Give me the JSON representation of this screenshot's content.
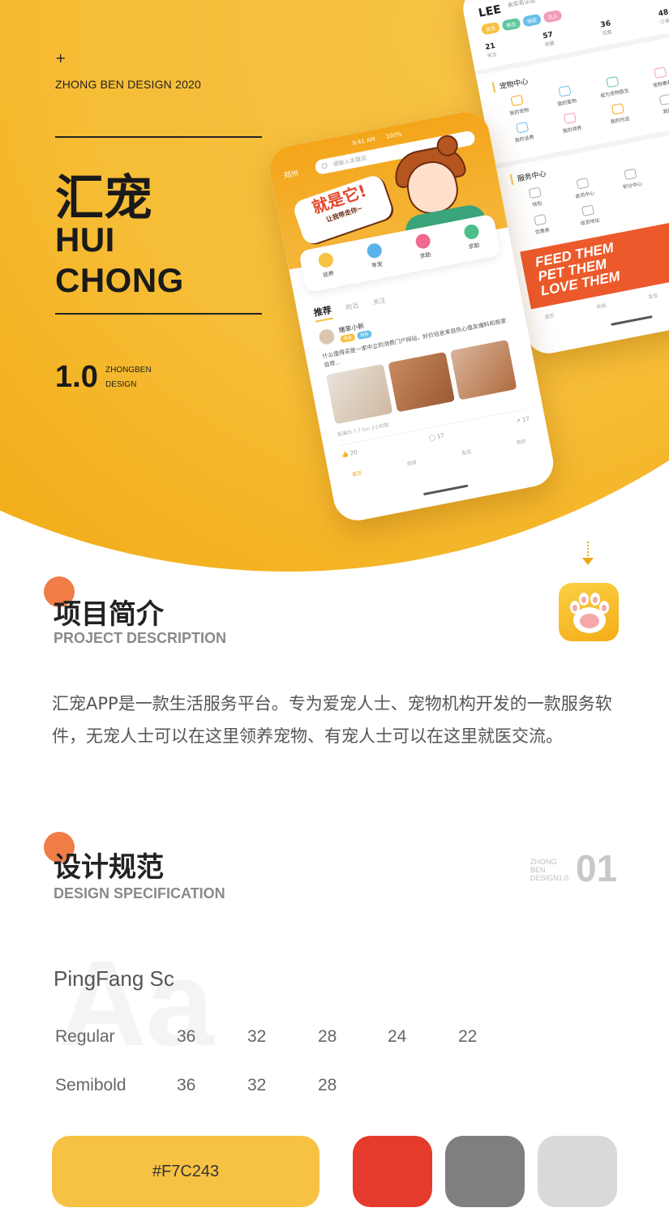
{
  "hero": {
    "plus": "+",
    "brand_line": "ZHONG BEN DESIGN 2020",
    "title_cn": "汇宠",
    "title_en_1": "HUI",
    "title_en_2": "CHONG",
    "version": "1.0",
    "version_sub_1": "ZHONGBEN",
    "version_sub_2": "DESIGN"
  },
  "back_phone": {
    "user": "LEE",
    "user_sub": "未实名认证",
    "tags": [
      "会员",
      "新生",
      "绑定",
      "达人"
    ],
    "stats": [
      {
        "value": "21",
        "label": "关注"
      },
      {
        "value": "57",
        "label": "收藏"
      },
      {
        "value": "36",
        "label": "回复"
      },
      {
        "value": "48",
        "label": "订单"
      }
    ],
    "pet_center": "宠物中心",
    "pet_items": [
      "我的宠物",
      "我的爱物",
      "成为宠物医生",
      "宠物寄养",
      "我的话费",
      "我的领养",
      "我的托运",
      "我的"
    ],
    "service_center": "服务中心",
    "service_items": [
      "钱包",
      "会员中心",
      "积分中心",
      "优惠券",
      "收货地址"
    ],
    "banner_1": "FEED THEM",
    "banner_2": "PET THEM",
    "banner_3": "LOVE THEM",
    "nav": [
      "首页",
      "商城",
      "发现",
      "我的"
    ]
  },
  "front_phone": {
    "status_time": "9:41 AM",
    "status_battery": "100%",
    "city": "郑州",
    "search_placeholder": "请输入关键词",
    "banner_main": "就是它!",
    "banner_sub": "让我带走你~",
    "quick": [
      "领养",
      "寻宠",
      "求助",
      "求助"
    ],
    "tab_active": "推荐",
    "tabs_other": [
      "附近",
      "关注"
    ],
    "post_name": "猪笨小新",
    "post_badges": [
      "萌宠",
      "狗狗"
    ],
    "post_text": "什么值得买是一家中立的消费门户网站，好价信息来自热心值友爆料和商家自荐...",
    "post_meta": "距离约 7.7 km   2小时前",
    "likes": "20",
    "comments": "17",
    "shares": "17",
    "nav": [
      "首页",
      "商城",
      "发现",
      "我的"
    ]
  },
  "sections": {
    "intro_cn": "项目简介",
    "intro_en": "PROJECT DESCRIPTION",
    "intro_text": "汇宠APP是一款生活服务平台。专为爱宠人士、宠物机构开发的一款服务软件，无宠人士可以在这里领养宠物、有宠人士可以在这里就医交流。",
    "spec_cn": "设计规范",
    "spec_en": "DESIGN SPECIFICATION",
    "spec_small_1": "ZHONG",
    "spec_small_2": "BEN",
    "spec_small_3": "DESIGN1.0",
    "spec_num": "01"
  },
  "typography": {
    "aa": "Aa",
    "font_name": "PingFang  Sc",
    "regular_label": "Regular",
    "regular_sizes": [
      "36",
      "32",
      "28",
      "24",
      "22"
    ],
    "semibold_label": "Semibold",
    "semibold_sizes": [
      "36",
      "32",
      "28"
    ]
  },
  "colors": {
    "primary_label": "#F7C243",
    "primary": "#F7C243",
    "red": "#E53B2C",
    "gray": "#7F7F7F",
    "light_gray": "#D9D9D9",
    "accent_orange": "#F07C46"
  }
}
